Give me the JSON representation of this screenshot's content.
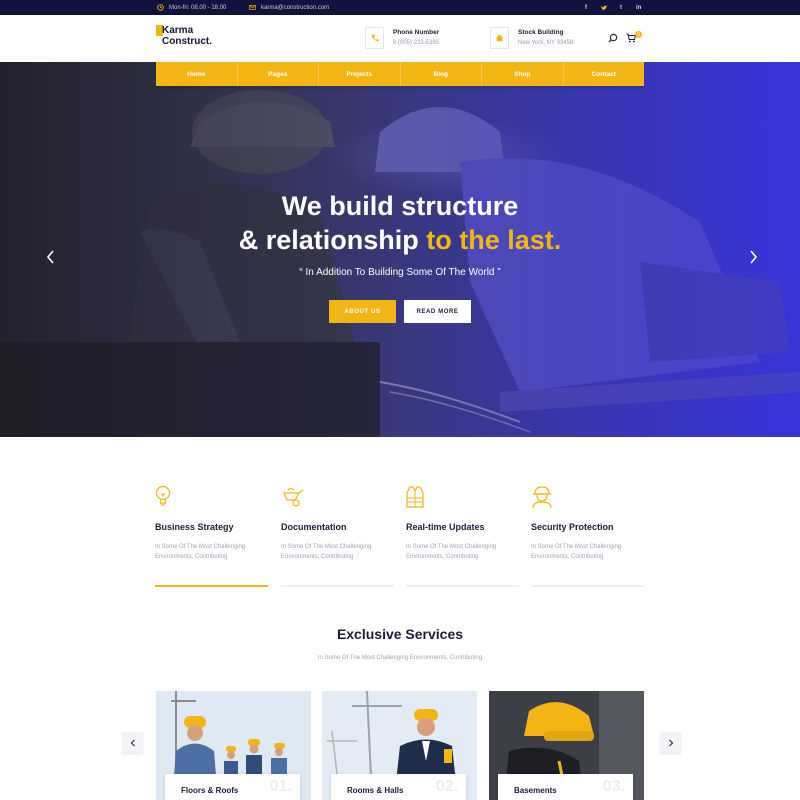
{
  "topbar": {
    "hours": "Mon-fri: 08.00 - 18.00",
    "email": "karma@construction.com",
    "social": [
      "f",
      "t",
      "t",
      "in"
    ]
  },
  "header": {
    "logo_line1": "Karma",
    "logo_line2": "Construct.",
    "phone_title": "Phone Number",
    "phone_value": "8 (005) 233-5385",
    "address_title": "Stock Building",
    "address_value": "New York, NY 93458",
    "cart_count": "0"
  },
  "nav": {
    "items": [
      "Home",
      "Pages",
      "Projects",
      "Blog",
      "Shop",
      "Contact"
    ]
  },
  "hero": {
    "line1": "We build structure",
    "line2_a": "& relationship ",
    "line2_b": "to the last.",
    "subtitle": "“ In Addition To Building Some Of The World ”",
    "btn_about": "ABOUT US",
    "btn_more": "READ MORE"
  },
  "features": [
    {
      "title": "Business Strategy",
      "desc": "In Some Of The Most Challenging Environments, Contributing",
      "icon": "lightbulb-icon"
    },
    {
      "title": "Documentation",
      "desc": "In Some Of The Most Challenging Environments, Contributing",
      "icon": "wheelbarrow-icon"
    },
    {
      "title": "Real-time Updates",
      "desc": "In Some Of The Most Challenging Environments, Contributing",
      "icon": "safety-vest-icon"
    },
    {
      "title": "Security Protection",
      "desc": "In Some Of The Most Challenging Environments, Contributing",
      "icon": "worker-icon"
    }
  ],
  "services": {
    "title": "Exclusive Services",
    "subtitle": "In Some Of The Most Challenging Environments, Contributing",
    "cards": [
      {
        "name": "Floors & Roofs",
        "num": "01."
      },
      {
        "name": "Rooms & Halls",
        "num": "02."
      },
      {
        "name": "Basements",
        "num": "03."
      }
    ]
  },
  "colors": {
    "accent": "#f2b514",
    "navy": "#12123f",
    "hero_blue": "#3b36d6"
  }
}
